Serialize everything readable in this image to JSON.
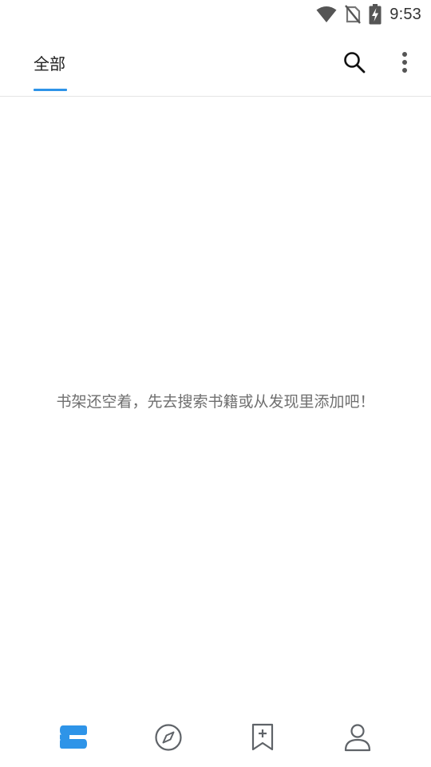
{
  "status_bar": {
    "time": "9:53",
    "icons": [
      "wifi-icon",
      "no-sim-icon",
      "battery-charging-icon"
    ]
  },
  "top_bar": {
    "active_tab_label": "全部",
    "accent_color": "#2e94e8",
    "actions": [
      "search-icon",
      "more-vert-icon"
    ]
  },
  "empty_state": {
    "message": "书架还空着，先去搜索书籍或从发现里添加吧！"
  },
  "bottom_nav": {
    "items": [
      "bookshelf-icon",
      "compass-icon",
      "bookmark-add-icon",
      "person-icon"
    ],
    "active_index": 0,
    "active_color": "#2e94e8",
    "inactive_color": "#5f6368"
  }
}
